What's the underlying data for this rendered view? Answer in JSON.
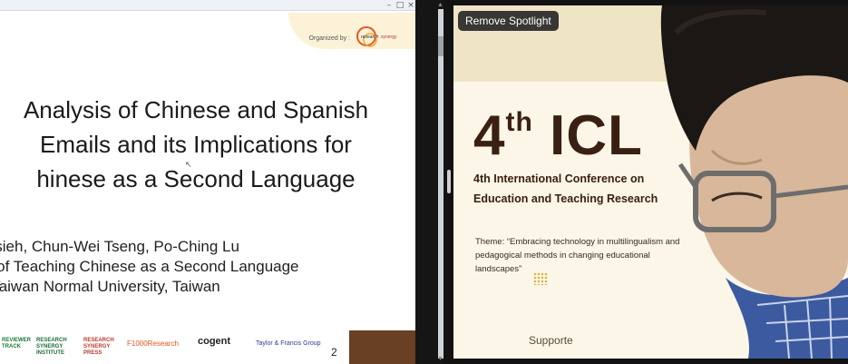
{
  "spotlight": {
    "button_label": "Remove Spotlight"
  },
  "slide": {
    "organizer_label": "Organized by :",
    "organizer_logo_text": "research synergy",
    "title_lines": [
      "Analysis of Chinese and Spanish",
      "Emails and its Implications for",
      "hinese as a Second Language"
    ],
    "author_lines": [
      " Hsieh, Chun-Wei Tseng, Po-Ching Lu",
      "e of Teaching Chinese as a Second Language",
      "l Taiwan Normal University, Taiwan"
    ],
    "sponsors": [
      {
        "name": "REVIEWER TRACK",
        "color": "#1e7b3a"
      },
      {
        "name": "RESEARCH SYNERGY INSTITUTE",
        "color": "#1f6b3a"
      },
      {
        "name": "RESEARCH SYNERGY PRESS",
        "color": "#c0392b"
      },
      {
        "name": "F1000Research",
        "color": "#e8571d"
      },
      {
        "name": "cogent",
        "color": "#222222"
      },
      {
        "name": "Taylor & Francis Group",
        "color": "#2a3b8f"
      }
    ],
    "page_number": "2"
  },
  "conference_banner": {
    "ordinal": "4",
    "ordinal_suffix": "th",
    "acronym": "ICL",
    "name_line1": "4th International Conference on",
    "name_line2": "Education and Teaching Research",
    "theme": "Theme: “Embracing technology in multilingualism and pedagogical methods in changing educational landscapes”",
    "supported": "Supporte"
  },
  "colors": {
    "banner_brown": "#3a2012",
    "banner_cream": "#fbf6e8",
    "sponsor_brown": "#6a4025"
  }
}
